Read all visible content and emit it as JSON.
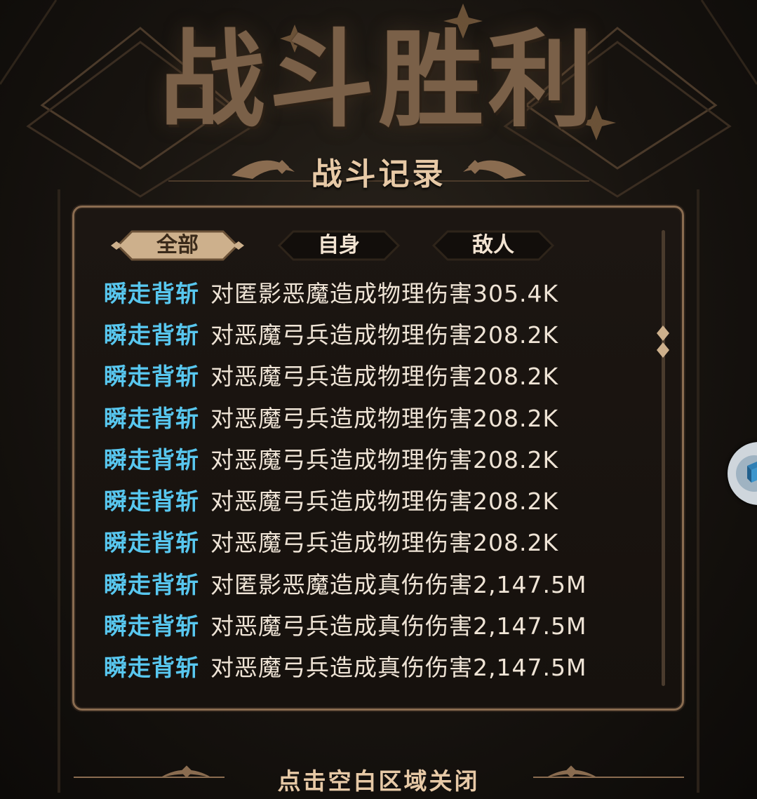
{
  "header": {
    "title": "战斗胜利",
    "subtitle": "战斗记录"
  },
  "tabs": [
    {
      "label": "全部",
      "active": true
    },
    {
      "label": "自身",
      "active": false
    },
    {
      "label": "敌人",
      "active": false
    }
  ],
  "log": [
    {
      "skill": "瞬走背斩",
      "text": "对匿影恶魔造成物理伤害305.4K"
    },
    {
      "skill": "瞬走背斩",
      "text": "对恶魔弓兵造成物理伤害208.2K"
    },
    {
      "skill": "瞬走背斩",
      "text": "对恶魔弓兵造成物理伤害208.2K"
    },
    {
      "skill": "瞬走背斩",
      "text": "对恶魔弓兵造成物理伤害208.2K"
    },
    {
      "skill": "瞬走背斩",
      "text": "对恶魔弓兵造成物理伤害208.2K"
    },
    {
      "skill": "瞬走背斩",
      "text": "对恶魔弓兵造成物理伤害208.2K"
    },
    {
      "skill": "瞬走背斩",
      "text": "对恶魔弓兵造成物理伤害208.2K"
    },
    {
      "skill": "瞬走背斩",
      "text": "对匿影恶魔造成真伤伤害2,147.5M"
    },
    {
      "skill": "瞬走背斩",
      "text": "对恶魔弓兵造成真伤伤害2,147.5M"
    },
    {
      "skill": "瞬走背斩",
      "text": "对恶魔弓兵造成真伤伤害2,147.5M"
    }
  ],
  "footer": {
    "close_hint": "点击空白区域关闭"
  },
  "colors": {
    "skill": "#58c7ef",
    "text": "#efe4d6",
    "accent": "#e7c9a6",
    "frame": "#8a6c50"
  },
  "icons": {
    "side_button": "cube-icon",
    "scroll_thumb": "diamond-scroll-icon"
  }
}
